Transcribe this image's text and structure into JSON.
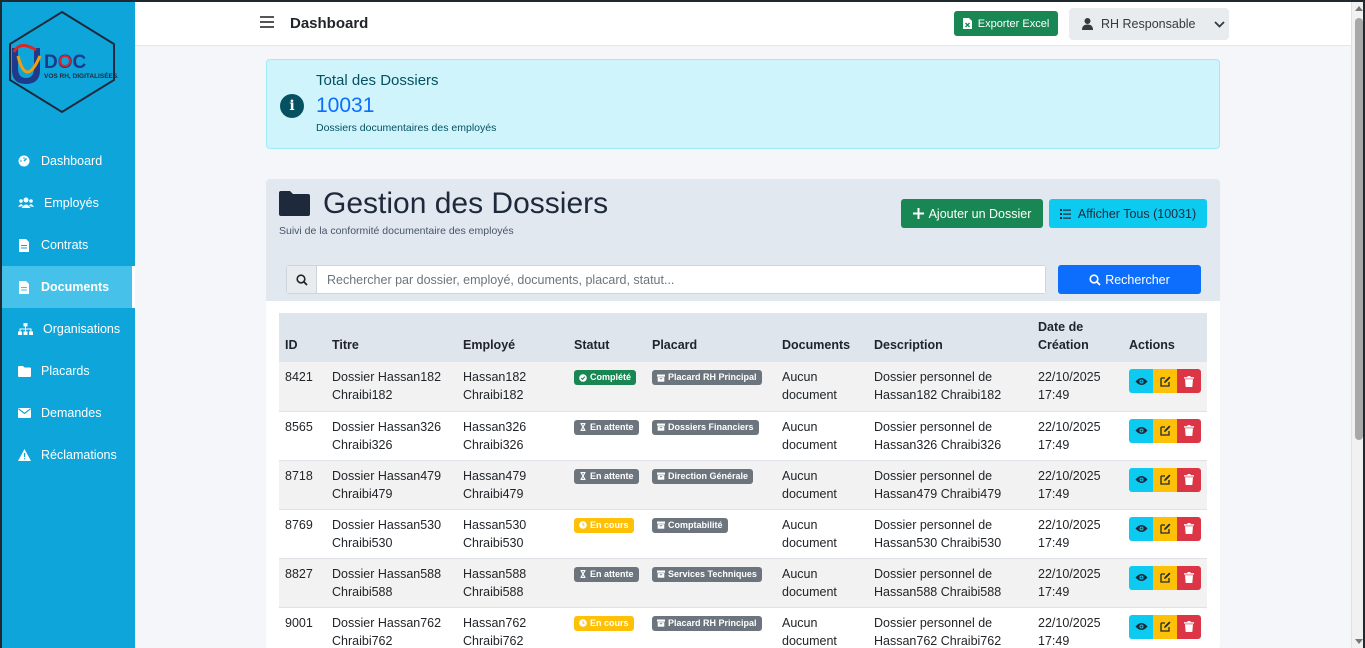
{
  "app": {
    "logo_text": "DOC",
    "logo_tagline": "VOS RH, DIGITALISÉES."
  },
  "sidebar": {
    "items": [
      {
        "label": "Dashboard",
        "icon": "dashboard-icon"
      },
      {
        "label": "Employés",
        "icon": "users-icon"
      },
      {
        "label": "Contrats",
        "icon": "file-icon"
      },
      {
        "label": "Documents",
        "icon": "document-icon",
        "active": true
      },
      {
        "label": "Organisations",
        "icon": "sitemap-icon"
      },
      {
        "label": "Placards",
        "icon": "folder-icon"
      },
      {
        "label": "Demandes",
        "icon": "envelope-icon"
      },
      {
        "label": "Réclamations",
        "icon": "warning-icon"
      }
    ]
  },
  "topbar": {
    "title": "Dashboard",
    "export_label": "Exporter Excel",
    "user_label": "RH Responsable"
  },
  "info": {
    "title": "Total des Dossiers",
    "value": "10031",
    "subtitle": "Dossiers documentaires des employés"
  },
  "card": {
    "title": "Gestion des Dossiers",
    "subtitle": "Suivi de la conformité documentaire des employés",
    "add_label": "Ajouter un Dossier",
    "show_all_label": "Afficher Tous (10031)",
    "search_placeholder": "Rechercher par dossier, employé, documents, placard, statut...",
    "search_value": "",
    "search_button": "Rechercher"
  },
  "table": {
    "headers": [
      "ID",
      "Titre",
      "Employé",
      "Statut",
      "Placard",
      "Documents",
      "Description",
      "Date de Création",
      "Actions"
    ],
    "rows": [
      {
        "id": "8421",
        "titre": "Dossier Hassan182 Chraibi182",
        "employe": "Hassan182 Chraibi182",
        "statut": "Complété",
        "statut_type": "success",
        "placard": "Placard RH Principal",
        "documents": "Aucun document",
        "description": "Dossier personnel de Hassan182 Chraibi182",
        "date": "22/10/2025 17:49"
      },
      {
        "id": "8565",
        "titre": "Dossier Hassan326 Chraibi326",
        "employe": "Hassan326 Chraibi326",
        "statut": "En attente",
        "statut_type": "secondary",
        "placard": "Dossiers Financiers",
        "documents": "Aucun document",
        "description": "Dossier personnel de Hassan326 Chraibi326",
        "date": "22/10/2025 17:49"
      },
      {
        "id": "8718",
        "titre": "Dossier Hassan479 Chraibi479",
        "employe": "Hassan479 Chraibi479",
        "statut": "En attente",
        "statut_type": "secondary",
        "placard": "Direction Générale",
        "documents": "Aucun document",
        "description": "Dossier personnel de Hassan479 Chraibi479",
        "date": "22/10/2025 17:49"
      },
      {
        "id": "8769",
        "titre": "Dossier Hassan530 Chraibi530",
        "employe": "Hassan530 Chraibi530",
        "statut": "En cours",
        "statut_type": "warning",
        "placard": "Comptabilité",
        "documents": "Aucun document",
        "description": "Dossier personnel de Hassan530 Chraibi530",
        "date": "22/10/2025 17:49"
      },
      {
        "id": "8827",
        "titre": "Dossier Hassan588 Chraibi588",
        "employe": "Hassan588 Chraibi588",
        "statut": "En attente",
        "statut_type": "secondary",
        "placard": "Services Techniques",
        "documents": "Aucun document",
        "description": "Dossier personnel de Hassan588 Chraibi588",
        "date": "22/10/2025 17:49"
      },
      {
        "id": "9001",
        "titre": "Dossier Hassan762 Chraibi762",
        "employe": "Hassan762 Chraibi762",
        "statut": "En cours",
        "statut_type": "warning",
        "placard": "Placard RH Principal",
        "documents": "Aucun document",
        "description": "Dossier personnel de Hassan762 Chraibi762",
        "date": "22/10/2025 17:49"
      }
    ]
  },
  "colors": {
    "sidebar": "#0ea5db",
    "sidebar_active": "#46c2ea",
    "success": "#198754",
    "info": "#0dcaf0",
    "warning": "#ffc107",
    "danger": "#dc3545",
    "primary": "#0d6efd"
  }
}
